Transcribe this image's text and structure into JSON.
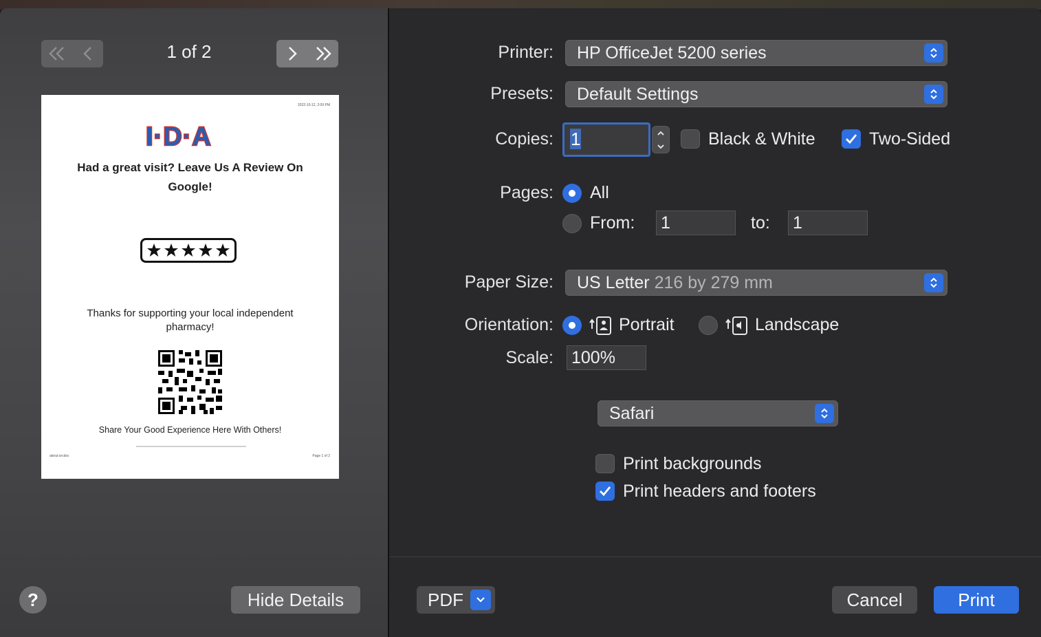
{
  "preview": {
    "page_indicator": "1 of 2",
    "page": {
      "timestamp": "2022-10-12, 2:09 PM",
      "logo_text": "I·D·A",
      "headline": "Had a great visit? Leave Us A Review On Google!",
      "rating_stars": 5,
      "thanks": "Thanks for supporting your local independent pharmacy!",
      "share": "Share Your Good Experience Here With Others!",
      "footer_left": "about:srcdoc",
      "footer_right": "Page 1 of 2"
    }
  },
  "buttons": {
    "help": "?",
    "hide_details": "Hide Details",
    "pdf": "PDF",
    "cancel": "Cancel",
    "print": "Print"
  },
  "settings": {
    "printer_label": "Printer:",
    "printer_value": "HP OfficeJet 5200 series",
    "presets_label": "Presets:",
    "presets_value": "Default Settings",
    "copies_label": "Copies:",
    "copies_value": "1",
    "black_white_label": "Black & White",
    "black_white_checked": false,
    "two_sided_label": "Two-Sided",
    "two_sided_checked": true,
    "pages_label": "Pages:",
    "pages_all_label": "All",
    "pages_from_label": "From:",
    "pages_from_value": "1",
    "pages_to_label": "to:",
    "pages_to_value": "1",
    "paper_size_label": "Paper Size:",
    "paper_size_value": "US Letter",
    "paper_size_detail": "216 by 279 mm",
    "orientation_label": "Orientation:",
    "portrait_label": "Portrait",
    "landscape_label": "Landscape",
    "scale_label": "Scale:",
    "scale_value": "100%",
    "app_section": "Safari",
    "print_backgrounds_label": "Print backgrounds",
    "print_backgrounds_checked": false,
    "print_headers_footers_label": "Print headers and footers",
    "print_headers_footers_checked": true
  },
  "colors": {
    "accent": "#2f6fe0",
    "panel": "#29292b",
    "preview_bg": "#4a4a4d"
  }
}
